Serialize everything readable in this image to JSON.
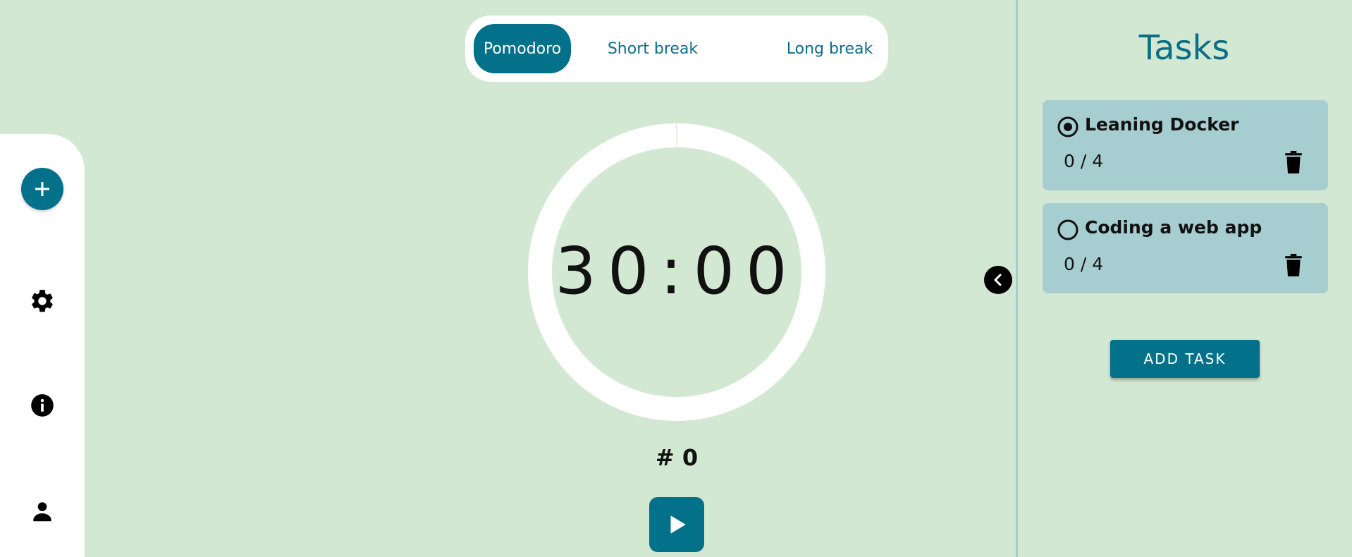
{
  "modes": {
    "items": [
      {
        "label": "Pomodoro",
        "active": true
      },
      {
        "label": "Short break",
        "active": false
      },
      {
        "label": "Long break",
        "active": false
      }
    ]
  },
  "timer": {
    "display": "30:00",
    "progress": 0,
    "session_count": "# 0"
  },
  "sidebar": {
    "icons": [
      "plus-icon",
      "gear-icon",
      "info-icon",
      "person-icon"
    ]
  },
  "tasks": {
    "title": "Tasks",
    "items": [
      {
        "name": "Leaning Docker",
        "count": "0 / 4",
        "selected": true
      },
      {
        "name": "Coding a web app",
        "count": "0 / 4",
        "selected": false
      }
    ],
    "add_label": "ADD TASK"
  },
  "colors": {
    "background": "#d3e8d3",
    "accent": "#03718a",
    "task_card": "#a6cdcf",
    "panel_divider": "#a6cbcb"
  }
}
